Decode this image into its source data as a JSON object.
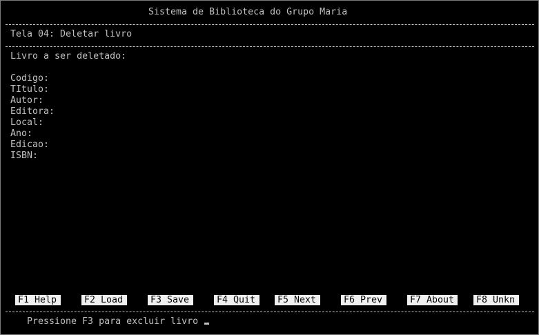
{
  "header": {
    "title": "Sistema de Biblioteca do Grupo Maria"
  },
  "screen": {
    "name": "Tela 04: Deletar livro",
    "prompt": "Livro a ser deletado:"
  },
  "fields": [
    {
      "label": "Codigo:"
    },
    {
      "label": "TItulo:"
    },
    {
      "label": "Autor:"
    },
    {
      "label": "Editora:"
    },
    {
      "label": "Local:"
    },
    {
      "label": "Ano:"
    },
    {
      "label": "Edicao:"
    },
    {
      "label": "ISBN:"
    }
  ],
  "function_keys": [
    {
      "label": "F1 Help"
    },
    {
      "label": "F2 Load"
    },
    {
      "label": "F3 Save"
    },
    {
      "label": "F4 Quit"
    },
    {
      "label": "F5 Next"
    },
    {
      "label": "F6 Prev"
    },
    {
      "label": "F7 About"
    },
    {
      "label": "F8 Unkn"
    }
  ],
  "status": {
    "message": "Pressione F3 para excluir livro"
  }
}
